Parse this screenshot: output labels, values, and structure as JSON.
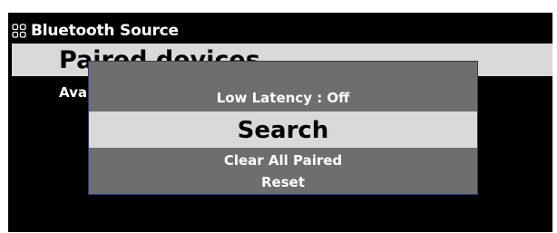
{
  "header": {
    "title": "Bluetooth Source",
    "icon": "grid-icon"
  },
  "menu": {
    "items": [
      {
        "label": "Paired devices",
        "selected": true
      },
      {
        "label": "Available devices",
        "selected": false
      }
    ]
  },
  "popup": {
    "items": [
      {
        "label": "Low Latency : Off",
        "selected": false
      },
      {
        "label": "Search",
        "selected": true
      },
      {
        "label": "Clear All Paired",
        "selected": false
      },
      {
        "label": "Reset",
        "selected": false
      }
    ]
  },
  "colors": {
    "screen_background": "#000000",
    "highlight": "#d9d9d9",
    "popup_background": "#6e6e6e",
    "popup_border": "#2a3a66",
    "text_light": "#ffffff",
    "text_dark": "#000000"
  }
}
